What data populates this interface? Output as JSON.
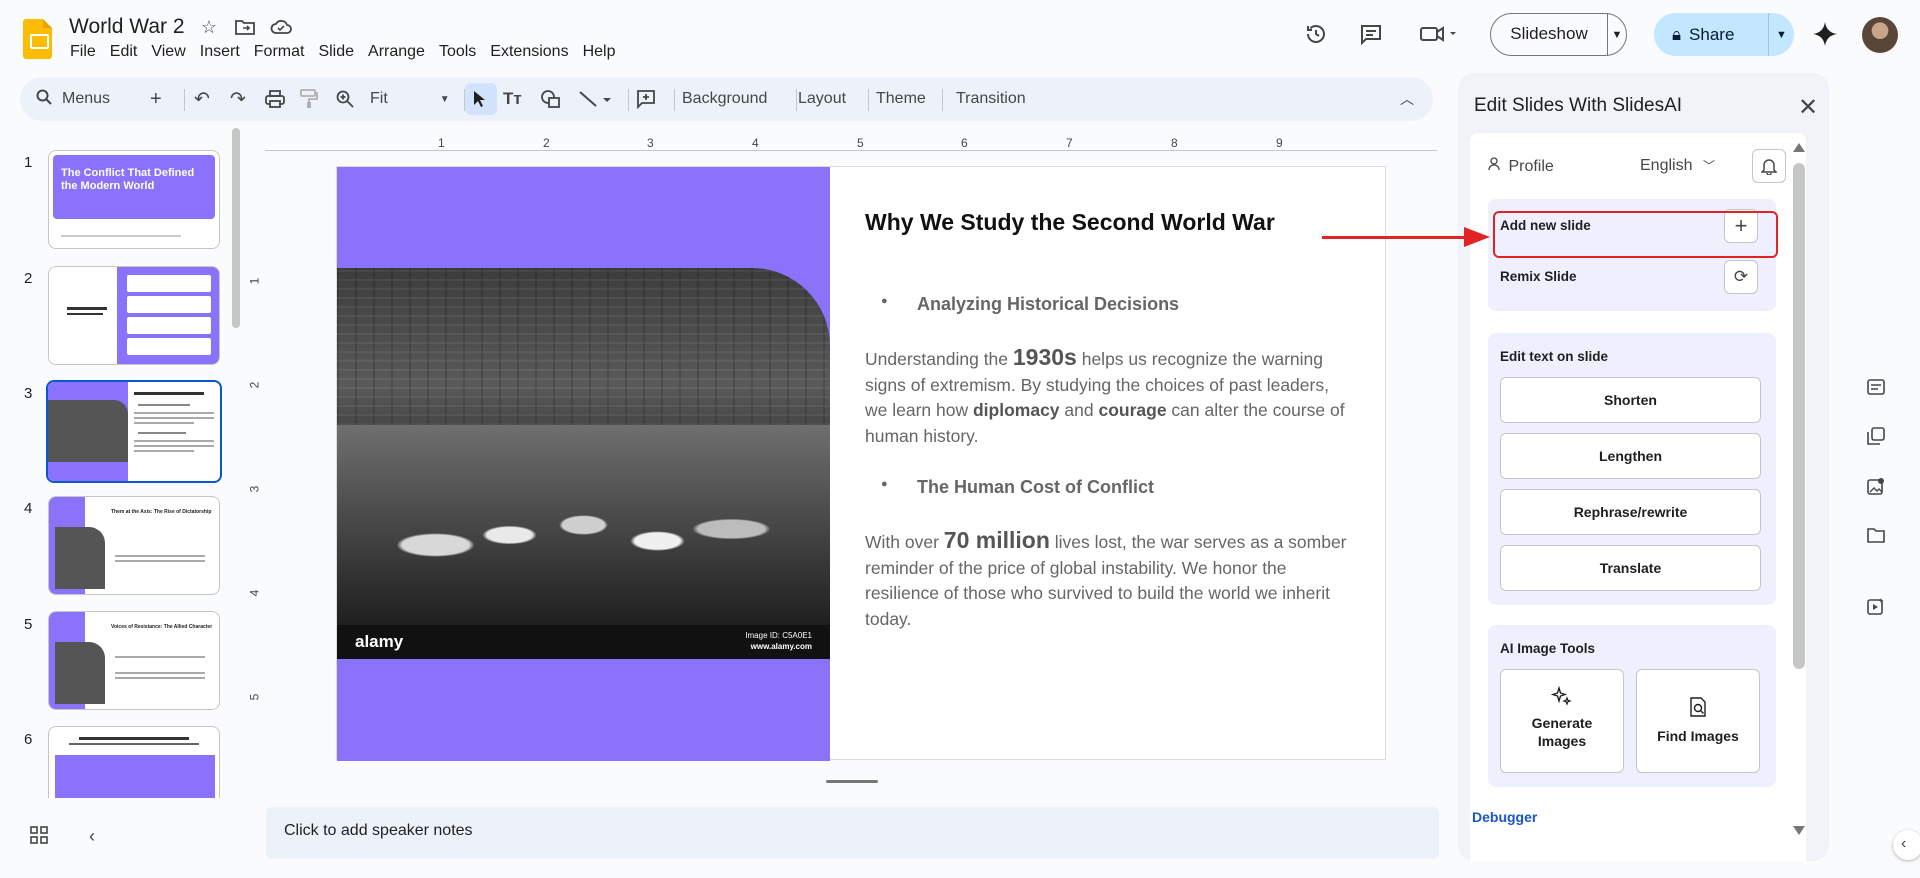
{
  "app": {
    "doc_title": "World War 2",
    "menu": [
      "File",
      "Edit",
      "View",
      "Insert",
      "Format",
      "Slide",
      "Arrange",
      "Tools",
      "Extensions",
      "Help"
    ],
    "slideshow_label": "Slideshow",
    "share_label": "Share"
  },
  "toolbar": {
    "search_label": "Menus",
    "zoom_label": "Fit",
    "background_label": "Background",
    "layout_label": "Layout",
    "theme_label": "Theme",
    "transition_label": "Transition"
  },
  "ruler": {
    "h_ticks": [
      "1",
      "2",
      "3",
      "4",
      "5",
      "6",
      "7",
      "8",
      "9"
    ],
    "v_ticks": [
      "1",
      "2",
      "3",
      "4",
      "5"
    ]
  },
  "filmstrip": {
    "numbers": [
      "1",
      "2",
      "3",
      "4",
      "5",
      "6"
    ],
    "thumb1_title": "The Conflict That Defined the Modern World",
    "thumb4_title": "Them at the Axis: The Rise of Dictatorship",
    "thumb5_title": "Voices of Resistance: The Allied Character"
  },
  "slide": {
    "title": "Why We Study the Second World War",
    "bullet1": "Analyzing Historical Decisions",
    "para1_a": "Understanding the ",
    "para1_big": "1930s",
    "para1_b": " helps us recognize the warning signs of extremism. By studying the choices of past leaders, we learn how ",
    "para1_bold1": "diplomacy",
    "para1_c": " and ",
    "para1_bold2": "courage",
    "para1_d": " can alter the course of human history.",
    "bullet2": "The Human Cost of Conflict",
    "para2_a": "With over ",
    "para2_big": "70 million",
    "para2_b": " lives lost, the war serves as a somber reminder of the price of global instability. We honor the resilience of those who survived to build the world we inherit today.",
    "photo_brand": "alamy",
    "photo_wm1": "Image ID: C5A0E1",
    "photo_wm2": "www.alamy.com"
  },
  "notes": {
    "placeholder": "Click to add speaker notes"
  },
  "panel": {
    "title": "Edit Slides With SlidesAI",
    "profile_label": "Profile",
    "language": "English",
    "add_slide_label": "Add new slide",
    "remix_label": "Remix Slide",
    "edit_text_header": "Edit text on slide",
    "edit_buttons": [
      "Shorten",
      "Lengthen",
      "Rephrase/rewrite",
      "Translate"
    ],
    "image_tools_header": "AI Image Tools",
    "generate_images": "Generate Images",
    "find_images": "Find Images",
    "debugger": "Debugger"
  },
  "colors": {
    "accent_purple": "#8b72fb",
    "annotation_red": "#e02424",
    "share_blue": "#c2e7ff",
    "selection_blue": "#0b57d0"
  }
}
